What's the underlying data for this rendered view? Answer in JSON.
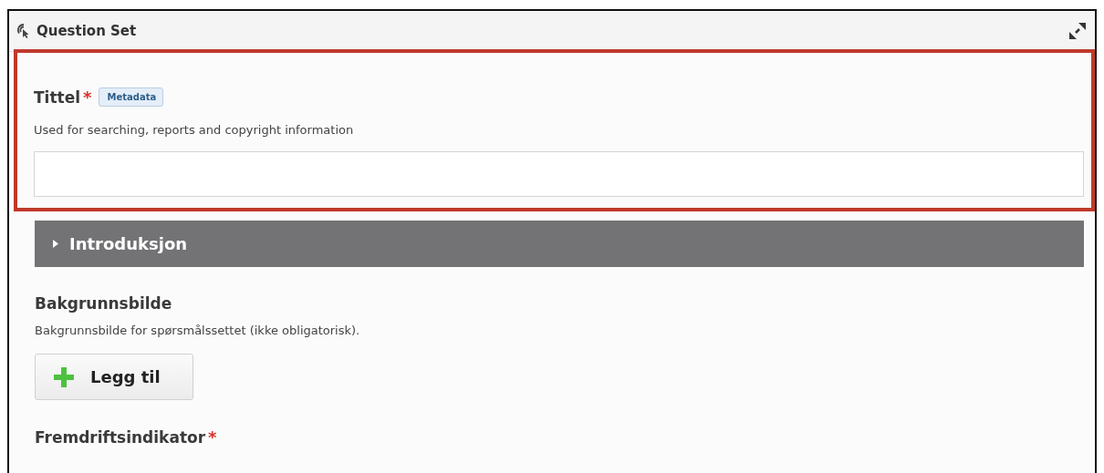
{
  "panel": {
    "title": "Question Set"
  },
  "highlighted_field": {
    "label": "Tittel",
    "required_mark": "*",
    "badge": "Metadata",
    "description": "Used for searching, reports and copyright information"
  },
  "section": {
    "label": "Introduksjon",
    "expanded": false
  },
  "image_field": {
    "label": "Bakgrunnsbilde",
    "description": "Bakgrunnsbilde for spørsmålssettet (ikke obligatorisk).",
    "button": "Legg til"
  },
  "progress_field": {
    "label": "Fremdriftsindikator",
    "required_mark": "*"
  }
}
